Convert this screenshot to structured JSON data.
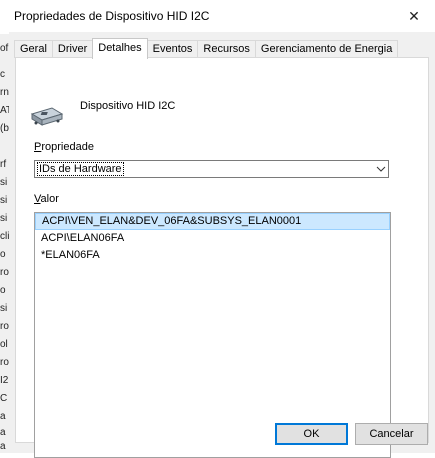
{
  "window": {
    "title": "Propriedades de Dispositivo HID I2C",
    "close_glyph": "✕"
  },
  "tabs": [
    {
      "label": "Geral"
    },
    {
      "label": "Driver"
    },
    {
      "label": "Detalhes"
    },
    {
      "label": "Eventos"
    },
    {
      "label": "Recursos"
    },
    {
      "label": "Gerenciamento de Energia"
    }
  ],
  "active_tab": "Detalhes",
  "device": {
    "name": "Dispositivo HID I2C",
    "icon": "hid-device-icon"
  },
  "property": {
    "label_mnemonic": "P",
    "label_rest": "ropriedade",
    "selected_value": "IDs de Hardware"
  },
  "value": {
    "label_mnemonic": "V",
    "label_rest": "alor",
    "items": [
      {
        "text": "ACPI\\VEN_ELAN&DEV_06FA&SUBSYS_ELAN0001"
      },
      {
        "text": "ACPI\\ELAN06FA"
      },
      {
        "text": "*ELAN06FA"
      }
    ]
  },
  "buttons": {
    "ok": "OK",
    "cancel": "Cancelar"
  },
  "background_window": {
    "fragments": [
      "of",
      "c",
      "rn",
      "AT",
      "(b",
      "rf",
      "si",
      "si",
      "si",
      "cli",
      "o",
      "ro",
      "o",
      "si",
      "ro",
      "ol",
      "ro",
      "I2",
      "C",
      "a",
      "a",
      "a"
    ]
  },
  "colors": {
    "selection": "#cce8ff",
    "ok_border": "#0078d7"
  }
}
